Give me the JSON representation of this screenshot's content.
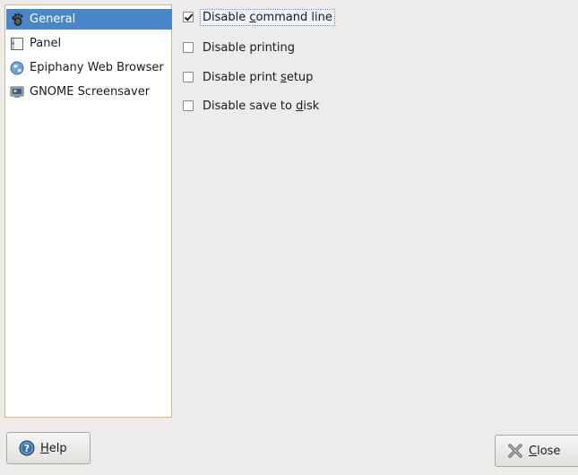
{
  "sidebar": {
    "items": [
      {
        "label": "General",
        "icon": "gnome-foot-icon",
        "selected": true
      },
      {
        "label": "Panel",
        "icon": "panel-icon",
        "selected": false
      },
      {
        "label": "Epiphany Web Browser",
        "icon": "globe-icon",
        "selected": false
      },
      {
        "label": "GNOME Screensaver",
        "icon": "monitor-icon",
        "selected": false
      }
    ]
  },
  "options": [
    {
      "pre": "Disable ",
      "mnemonic": "c",
      "post": "ommand line",
      "checked": true,
      "focused": true
    },
    {
      "pre": "Disable printing",
      "mnemonic": "",
      "post": "",
      "checked": false,
      "focused": false
    },
    {
      "pre": "Disable print ",
      "mnemonic": "s",
      "post": "etup",
      "checked": false,
      "focused": false
    },
    {
      "pre": "Disable save to ",
      "mnemonic": "d",
      "post": "isk",
      "checked": false,
      "focused": false
    }
  ],
  "buttons": {
    "help": {
      "mnemonic": "H",
      "rest": "elp",
      "icon": "help-icon"
    },
    "close": {
      "mnemonic": "C",
      "rest": "lose",
      "icon": "close-icon"
    }
  },
  "colors": {
    "selection": "#4a86c8",
    "window_bg": "#edeceb",
    "sidebar_border": "#c9b98e"
  }
}
